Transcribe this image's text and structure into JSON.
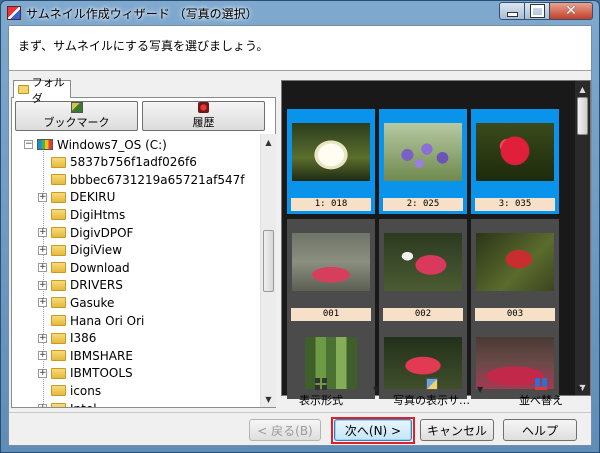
{
  "window": {
    "title": "サムネイル作成ウィザード （写真の選択）",
    "icon": "app-icon"
  },
  "instruction": "まず、サムネイルにする写真を選びましょう。",
  "left_panel": {
    "tab_label": "フォルダ",
    "bookmark_label": "ブックマーク",
    "history_label": "履歴",
    "tree": [
      {
        "label": "Windows7_OS (C:)",
        "level": 0,
        "type": "drive",
        "expander": "−"
      },
      {
        "label": "5837b756f1adf026f6",
        "level": 1,
        "type": "folder",
        "expander": ""
      },
      {
        "label": "bbbec6731219a65721af547f",
        "level": 1,
        "type": "folder",
        "expander": ""
      },
      {
        "label": "DEKIRU",
        "level": 1,
        "type": "folder",
        "expander": "+"
      },
      {
        "label": "DigiHtms",
        "level": 1,
        "type": "folder",
        "expander": ""
      },
      {
        "label": "DigivDPOF",
        "level": 1,
        "type": "folder",
        "expander": "+"
      },
      {
        "label": "DigiView",
        "level": 1,
        "type": "folder",
        "expander": "+"
      },
      {
        "label": "Download",
        "level": 1,
        "type": "folder",
        "expander": "+"
      },
      {
        "label": "DRIVERS",
        "level": 1,
        "type": "folder",
        "expander": "+"
      },
      {
        "label": "Gasuke",
        "level": 1,
        "type": "folder",
        "expander": "+"
      },
      {
        "label": "Hana Ori Ori",
        "level": 1,
        "type": "folder",
        "expander": ""
      },
      {
        "label": "I386",
        "level": 1,
        "type": "folder",
        "expander": "+"
      },
      {
        "label": "IBMSHARE",
        "level": 1,
        "type": "folder",
        "expander": "+"
      },
      {
        "label": "IBMTOOLS",
        "level": 1,
        "type": "folder",
        "expander": "+"
      },
      {
        "label": "icons",
        "level": 1,
        "type": "folder",
        "expander": ""
      },
      {
        "label": "Intel",
        "level": 1,
        "type": "folder",
        "expander": "+"
      }
    ]
  },
  "thumbnails": [
    {
      "caption": "1: 018",
      "selected": true,
      "photo": "white-water-lily"
    },
    {
      "caption": "2: 025",
      "selected": true,
      "photo": "purple-flowers"
    },
    {
      "caption": "3: 035",
      "selected": true,
      "photo": "red-ixora"
    },
    {
      "caption": "001",
      "selected": false,
      "photo": "red-spider-lily-1"
    },
    {
      "caption": "002",
      "selected": false,
      "photo": "red-spider-lily-2"
    },
    {
      "caption": "003",
      "selected": false,
      "photo": "red-spider-lily-3"
    },
    {
      "caption": "",
      "selected": false,
      "photo": "green-bamboo"
    },
    {
      "caption": "",
      "selected": false,
      "photo": "red-spider-lily-4"
    },
    {
      "caption": "",
      "selected": false,
      "photo": "red-spider-lily-field"
    }
  ],
  "view_toolbar": {
    "display_format": "表示形式",
    "thumb_size": "写真の表示サ…",
    "sort": "並べ替え"
  },
  "footer": {
    "back": "< 戻る(B)",
    "next": "次へ(N) >",
    "cancel": "キャンセル",
    "help": "ヘルプ"
  },
  "colors": {
    "selected": "#0a93ea",
    "caption_bg": "#f6e0c8",
    "highlight": "#e0202a"
  }
}
